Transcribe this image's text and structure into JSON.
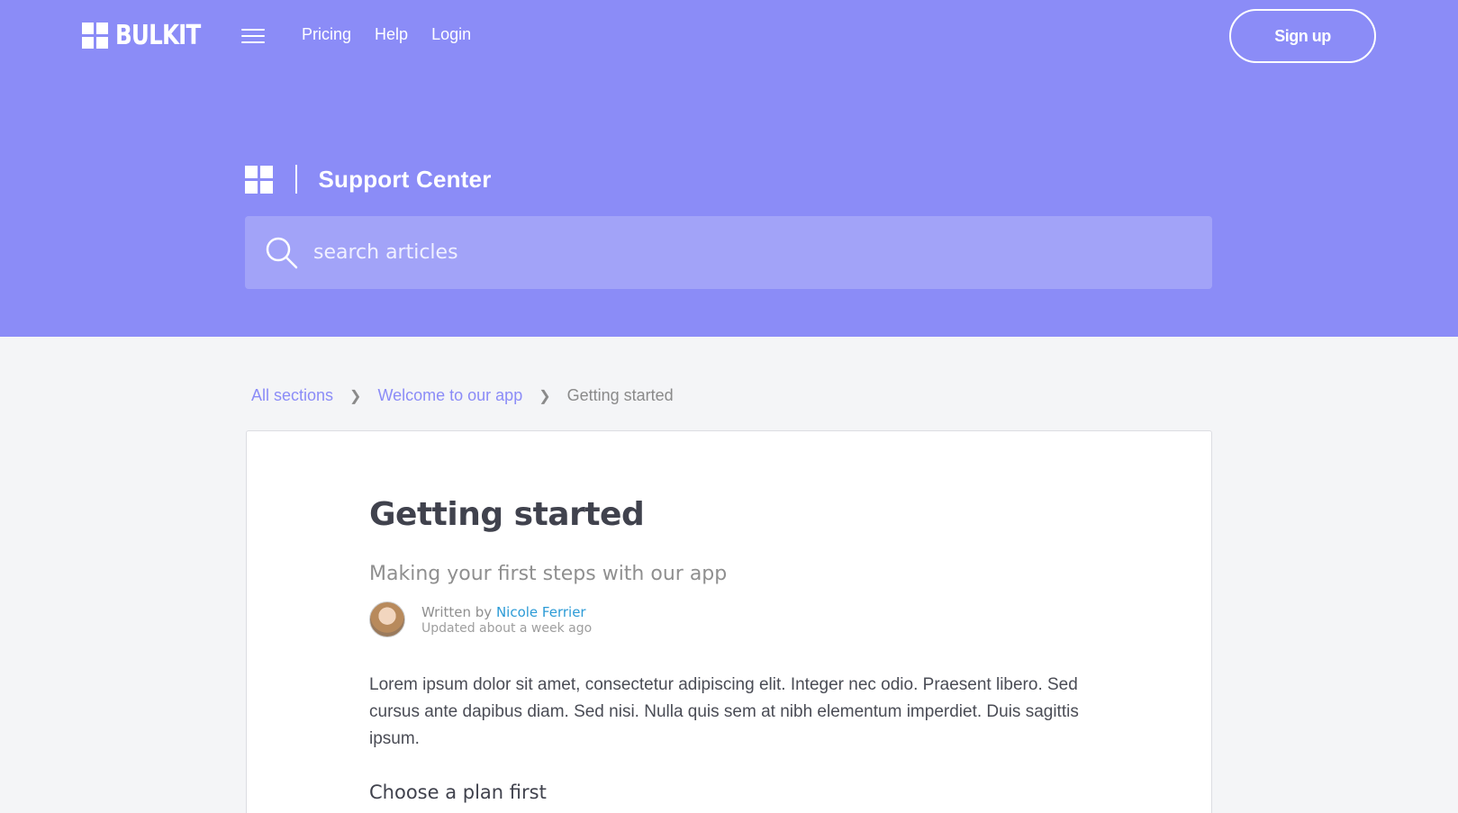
{
  "header": {
    "logo_text": "BULKIT",
    "nav": [
      "Pricing",
      "Help",
      "Login"
    ],
    "signup_label": "Sign up"
  },
  "hero": {
    "title": "Support Center",
    "search_placeholder": "search articles"
  },
  "breadcrumb": {
    "items": [
      "All sections",
      "Welcome to our app"
    ],
    "current": "Getting started"
  },
  "article": {
    "title": "Getting started",
    "subtitle": "Making your first steps with our app",
    "written_by": "Written by ",
    "author": "Nicole Ferrier",
    "updated": "Updated about a week ago",
    "body": "Lorem ipsum dolor sit amet, consectetur adipiscing elit. Integer nec odio. Praesent libero. Sed cursus ante dapibus diam. Sed nisi. Nulla quis sem at nibh elementum imperdiet. Duis sagittis ipsum.",
    "section_heading": "Choose a plan first"
  },
  "colors": {
    "accent": "#8b8cf7",
    "link": "#2c9bd6"
  }
}
